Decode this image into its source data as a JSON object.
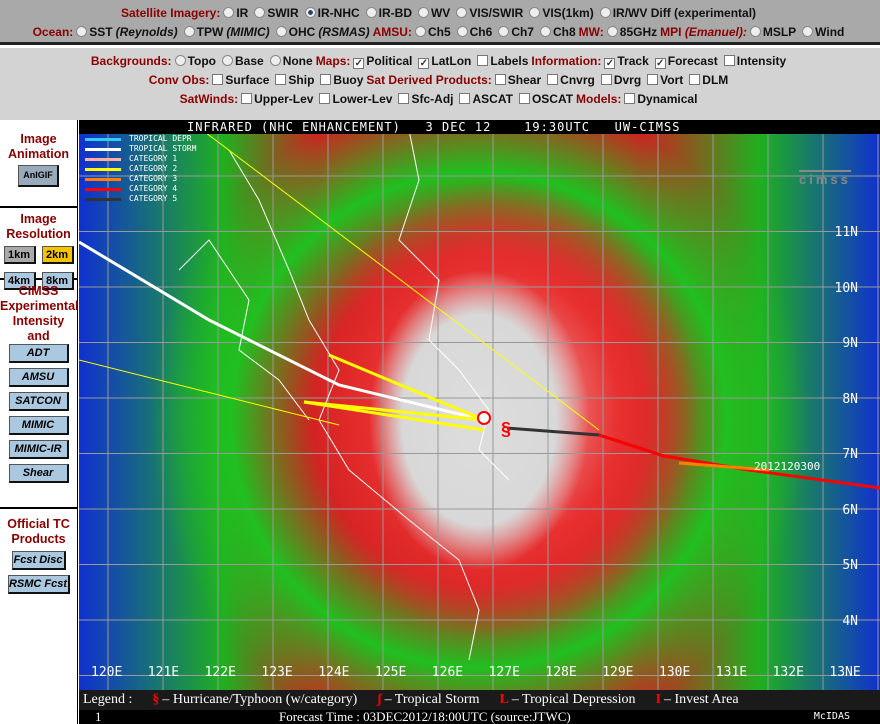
{
  "row1": {
    "label": "Satellite Imagery:",
    "options": [
      "IR",
      "SWIR",
      "IR-NHC",
      "IR-BD",
      "WV",
      "VIS/SWIR",
      "VIS(1km)",
      "IR/WV Diff (experimental)"
    ],
    "selected": "IR-NHC"
  },
  "row2": {
    "ocean_label": "Ocean:",
    "ocean": [
      "SST",
      "TPW",
      "OHC"
    ],
    "ocean_src": [
      "(Reynolds)",
      "(MIMIC)",
      "(RSMAS)"
    ],
    "amsu_label": "AMSU:",
    "amsu": [
      "Ch5",
      "Ch6",
      "Ch7",
      "Ch8"
    ],
    "mw_label": "MW:",
    "mw": [
      "85GHz"
    ],
    "mpi_label": "MPI",
    "mpi_src": "(Emanuel):",
    "mpi": [
      "MSLP",
      "Wind"
    ]
  },
  "row3": {
    "bg_label": "Backgrounds:",
    "bg": [
      "Topo",
      "Base",
      "None"
    ],
    "maps_label": "Maps:",
    "maps": [
      "Political",
      "LatLon",
      "Labels"
    ],
    "info_label": "Information:",
    "info": [
      "Track",
      "Forecast",
      "Intensity"
    ]
  },
  "row4": {
    "conv_label": "Conv Obs:",
    "conv": [
      "Surface",
      "Ship",
      "Buoy"
    ],
    "sat_label": "Sat Derived Products:",
    "sat": [
      "Shear",
      "Cnvrg",
      "Dvrg",
      "Vort",
      "DLM"
    ]
  },
  "row5": {
    "sw_label": "SatWinds:",
    "sw": [
      "Upper-Lev",
      "Lower-Lev",
      "Sfc-Adj",
      "ASCAT",
      "OSCAT"
    ],
    "models_label": "Models:",
    "models": [
      "Dynamical"
    ]
  },
  "side": {
    "anim_title": "Image Animation",
    "anim_btn": "AnIGIF",
    "res_title": "Image Resolution",
    "res": [
      "1km",
      "2km",
      "4km",
      "8km"
    ],
    "res_selected": "2km",
    "cimss_title": "CIMSS Experimental Intensity and Structure Products",
    "products": [
      "ADT",
      "AMSU",
      "SATCON",
      "MIMIC",
      "MIMIC-IR",
      "Shear"
    ],
    "official_title": "Official TC Products",
    "official": [
      "Fcst Disc",
      "RSMC Fcst"
    ]
  },
  "map": {
    "title": "INFRARED (NHC ENHANCEMENT)   3 DEC 12    19:30UTC   UW-CIMSS",
    "legend": [
      {
        "label": "TROPICAL DEPR",
        "color": "#33ccff"
      },
      {
        "label": "TROPICAL STORM",
        "color": "#ffffff"
      },
      {
        "label": "CATEGORY 1",
        "color": "#ffb0a0"
      },
      {
        "label": "CATEGORY 2",
        "color": "#ffff00"
      },
      {
        "label": "CATEGORY 3",
        "color": "#ff8000"
      },
      {
        "label": "CATEGORY 4",
        "color": "#ff0000"
      },
      {
        "label": "CATEGORY 5",
        "color": "#333333"
      }
    ],
    "lons": [
      "120E",
      "121E",
      "122E",
      "123E",
      "124E",
      "125E",
      "126E",
      "127E",
      "128E",
      "129E",
      "130E",
      "131E",
      "132E",
      "13NE"
    ],
    "lats": [
      "11N",
      "10N",
      "9N",
      "8N",
      "7N",
      "6N",
      "5N",
      "4N"
    ],
    "track_label": "2012120300",
    "logo": "CIMSS"
  },
  "legend": {
    "title": "Legend :",
    "items": [
      {
        "sym": "§",
        "label": "– Hurricane/Typhoon (w/category)"
      },
      {
        "sym": "ʃ",
        "label": "– Tropical Storm"
      },
      {
        "sym": "L",
        "label": "– Tropical Depression"
      },
      {
        "sym": "I",
        "label": "– Invest Area"
      }
    ]
  },
  "footer": {
    "frame": "1",
    "forecast": "Forecast Time : 03DEC2012/18:00UTC (source:JTWC)",
    "brand": "McIDAS"
  }
}
